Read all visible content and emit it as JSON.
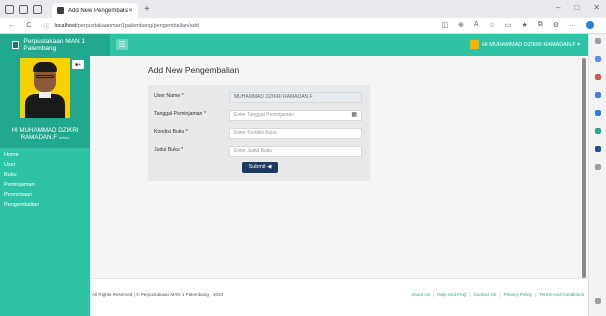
{
  "browser": {
    "tab_title": "Add New Pengembalian",
    "url_host": "localhost",
    "url_path": "/perpustakaanman1palembang/pengembalian/add",
    "nav": {
      "back": "←",
      "reload": "C",
      "info": "ⓘ"
    },
    "window": {
      "minimize": "–",
      "maximize": "□",
      "close": "✕"
    },
    "tab_close": "✕",
    "new_tab": "+"
  },
  "header": {
    "brand": "Perpustakaan MAN 1 Palembang",
    "menu_icon": "☰",
    "user": "HI MUHAMMAD DZIKRI RAMADAN.F ▾"
  },
  "sidebar": {
    "profile_button": "■+",
    "name_line1": "HI MUHAMMAD DZIKRI",
    "name_line2": "RAMADAN.F",
    "status": "online",
    "items": [
      "Home",
      "User",
      "Buku",
      "Peminjaman",
      "Permintaan",
      "Pengembalian"
    ]
  },
  "main": {
    "title": "Add New Pengembalian",
    "form": {
      "user_name": {
        "label": "User Name *",
        "value": "MUHAMMAD DZIKRI RAMADAN.F"
      },
      "tanggal": {
        "label": "Tanggal Peminjaman *",
        "placeholder": "Enter Tanggal Peminjaman"
      },
      "kondisi": {
        "label": "Kondisi Buku *",
        "placeholder": "Enter Kondisi Buku"
      },
      "judul": {
        "label": "Judul Buku *",
        "placeholder": "Enter Judul Buku"
      },
      "submit": "Submit ◀"
    }
  },
  "footer": {
    "copyright": "All Rights Reserved | © Perpustakaan MAN 1 Palembang - 2024",
    "links": [
      "About Us",
      "Help And FAQ",
      "Contact Us",
      "Privacy Policy",
      "Terms And Conditions"
    ],
    "separator": "|"
  },
  "colors": {
    "accent": "#2ec3a5",
    "accent_dark": "#22a98d",
    "button": "#1f3a5f"
  }
}
